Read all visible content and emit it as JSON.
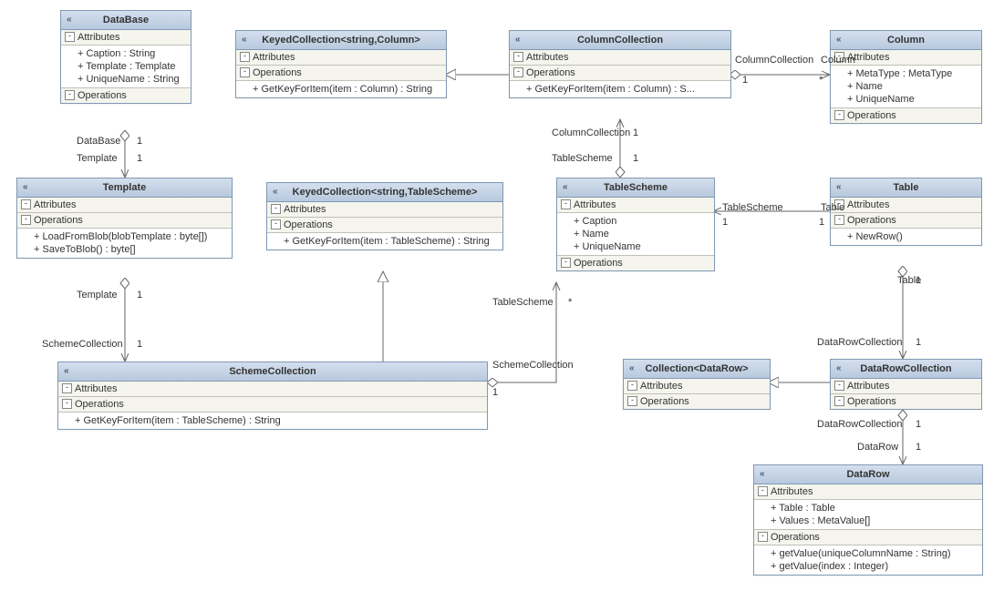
{
  "classes": {
    "database": {
      "name": "DataBase",
      "attrs_label": "Attributes",
      "ops_label": "Operations",
      "attrs": [
        "+ Caption : String",
        "+ Template : Template",
        "+ UniqueName : String"
      ]
    },
    "keyedColumn": {
      "name": "KeyedCollection<string,Column>",
      "attrs_label": "Attributes",
      "ops_label": "Operations",
      "ops": [
        "+ GetKeyForItem(item : Column) : String"
      ]
    },
    "columnCollection": {
      "name": "ColumnCollection",
      "attrs_label": "Attributes",
      "ops_label": "Operations",
      "ops": [
        "+ GetKeyForItem(item : Column) : S..."
      ]
    },
    "column": {
      "name": "Column",
      "attrs_label": "Attributes",
      "ops_label": "Operations",
      "attrs": [
        "+ MetaType : MetaType",
        "+ Name",
        "+ UniqueName"
      ]
    },
    "template": {
      "name": "Template",
      "attrs_label": "Attributes",
      "ops_label": "Operations",
      "ops": [
        "+ LoadFromBlob(blobTemplate : byte[])",
        "+ SaveToBlob() : byte[]"
      ]
    },
    "keyedTableScheme": {
      "name": "KeyedCollection<string,TableScheme>",
      "attrs_label": "Attributes",
      "ops_label": "Operations",
      "ops": [
        "+ GetKeyForItem(item : TableScheme) : String"
      ]
    },
    "tableScheme": {
      "name": "TableScheme",
      "attrs_label": "Attributes",
      "ops_label": "Operations",
      "attrs": [
        "+ Caption",
        "+ Name",
        "+ UniqueName"
      ]
    },
    "table": {
      "name": "Table",
      "attrs_label": "Attributes",
      "ops_label": "Operations",
      "ops": [
        "+ NewRow()"
      ]
    },
    "schemeCollection": {
      "name": "SchemeCollection",
      "attrs_label": "Attributes",
      "ops_label": "Operations",
      "ops": [
        "+ GetKeyForItem(item : TableScheme) : String"
      ]
    },
    "collectionDataRow": {
      "name": "Collection<DataRow>",
      "attrs_label": "Attributes",
      "ops_label": "Operations"
    },
    "dataRowCollection": {
      "name": "DataRowCollection",
      "attrs_label": "Attributes",
      "ops_label": "Operations"
    },
    "dataRow": {
      "name": "DataRow",
      "attrs_label": "Attributes",
      "ops_label": "Operations",
      "attrs": [
        "+ Table : Table",
        "+ Values : MetaValue[]"
      ],
      "ops": [
        "+ getValue(uniqueColumnName : String)",
        "+ getValue(index : Integer)"
      ]
    }
  },
  "labels": {
    "dbTemplate_a": "DataBase",
    "dbTemplate_b": "Template",
    "one": "1",
    "templScheme_a": "Template",
    "templScheme_b": "SchemeCollection",
    "schemeTS_a": "SchemeCollection",
    "schemeTS_b": "TableScheme",
    "star": "*",
    "tsCC_a": "TableScheme",
    "tsCC_b": "ColumnCollection",
    "ccCol_a": "ColumnCollection",
    "ccCol_b": "Column",
    "tsTable_a": "TableScheme",
    "tsTable_b": "Table",
    "tableDRC_a": "Table",
    "tableDRC_b": "DataRowCollection",
    "drcDR_a": "DataRowCollection",
    "drcDR_b": "DataRow"
  }
}
